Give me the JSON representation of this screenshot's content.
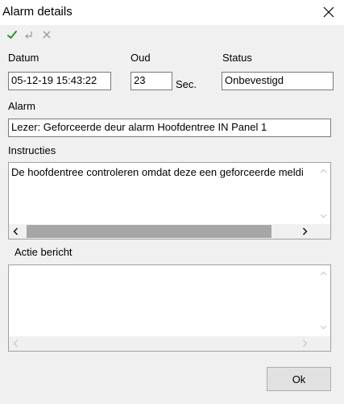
{
  "window": {
    "title": "Alarm details"
  },
  "icons": {
    "close": "close-icon",
    "confirm": "checkmark-icon",
    "undo": "undo-icon",
    "cancel": "x-icon"
  },
  "colors": {
    "confirm_green": "#1e9c1e",
    "disabled_gray": "#9a9a9a"
  },
  "fields": {
    "datum": {
      "label": "Datum",
      "value": "05-12-19 15:43:22"
    },
    "oud": {
      "label": "Oud",
      "value": "23",
      "unit": "Sec."
    },
    "status": {
      "label": "Status",
      "value": "Onbevestigd"
    },
    "alarm": {
      "label": "Alarm",
      "value": "Lezer: Geforceerde deur alarm Hoofdentree IN  Panel 1"
    },
    "instructies": {
      "label": "Instructies",
      "value": "De hoofdentree controleren omdat deze een geforceerde meldi"
    },
    "actie_bericht": {
      "label": "Actie bericht",
      "value": ""
    }
  },
  "buttons": {
    "ok": "Ok"
  }
}
